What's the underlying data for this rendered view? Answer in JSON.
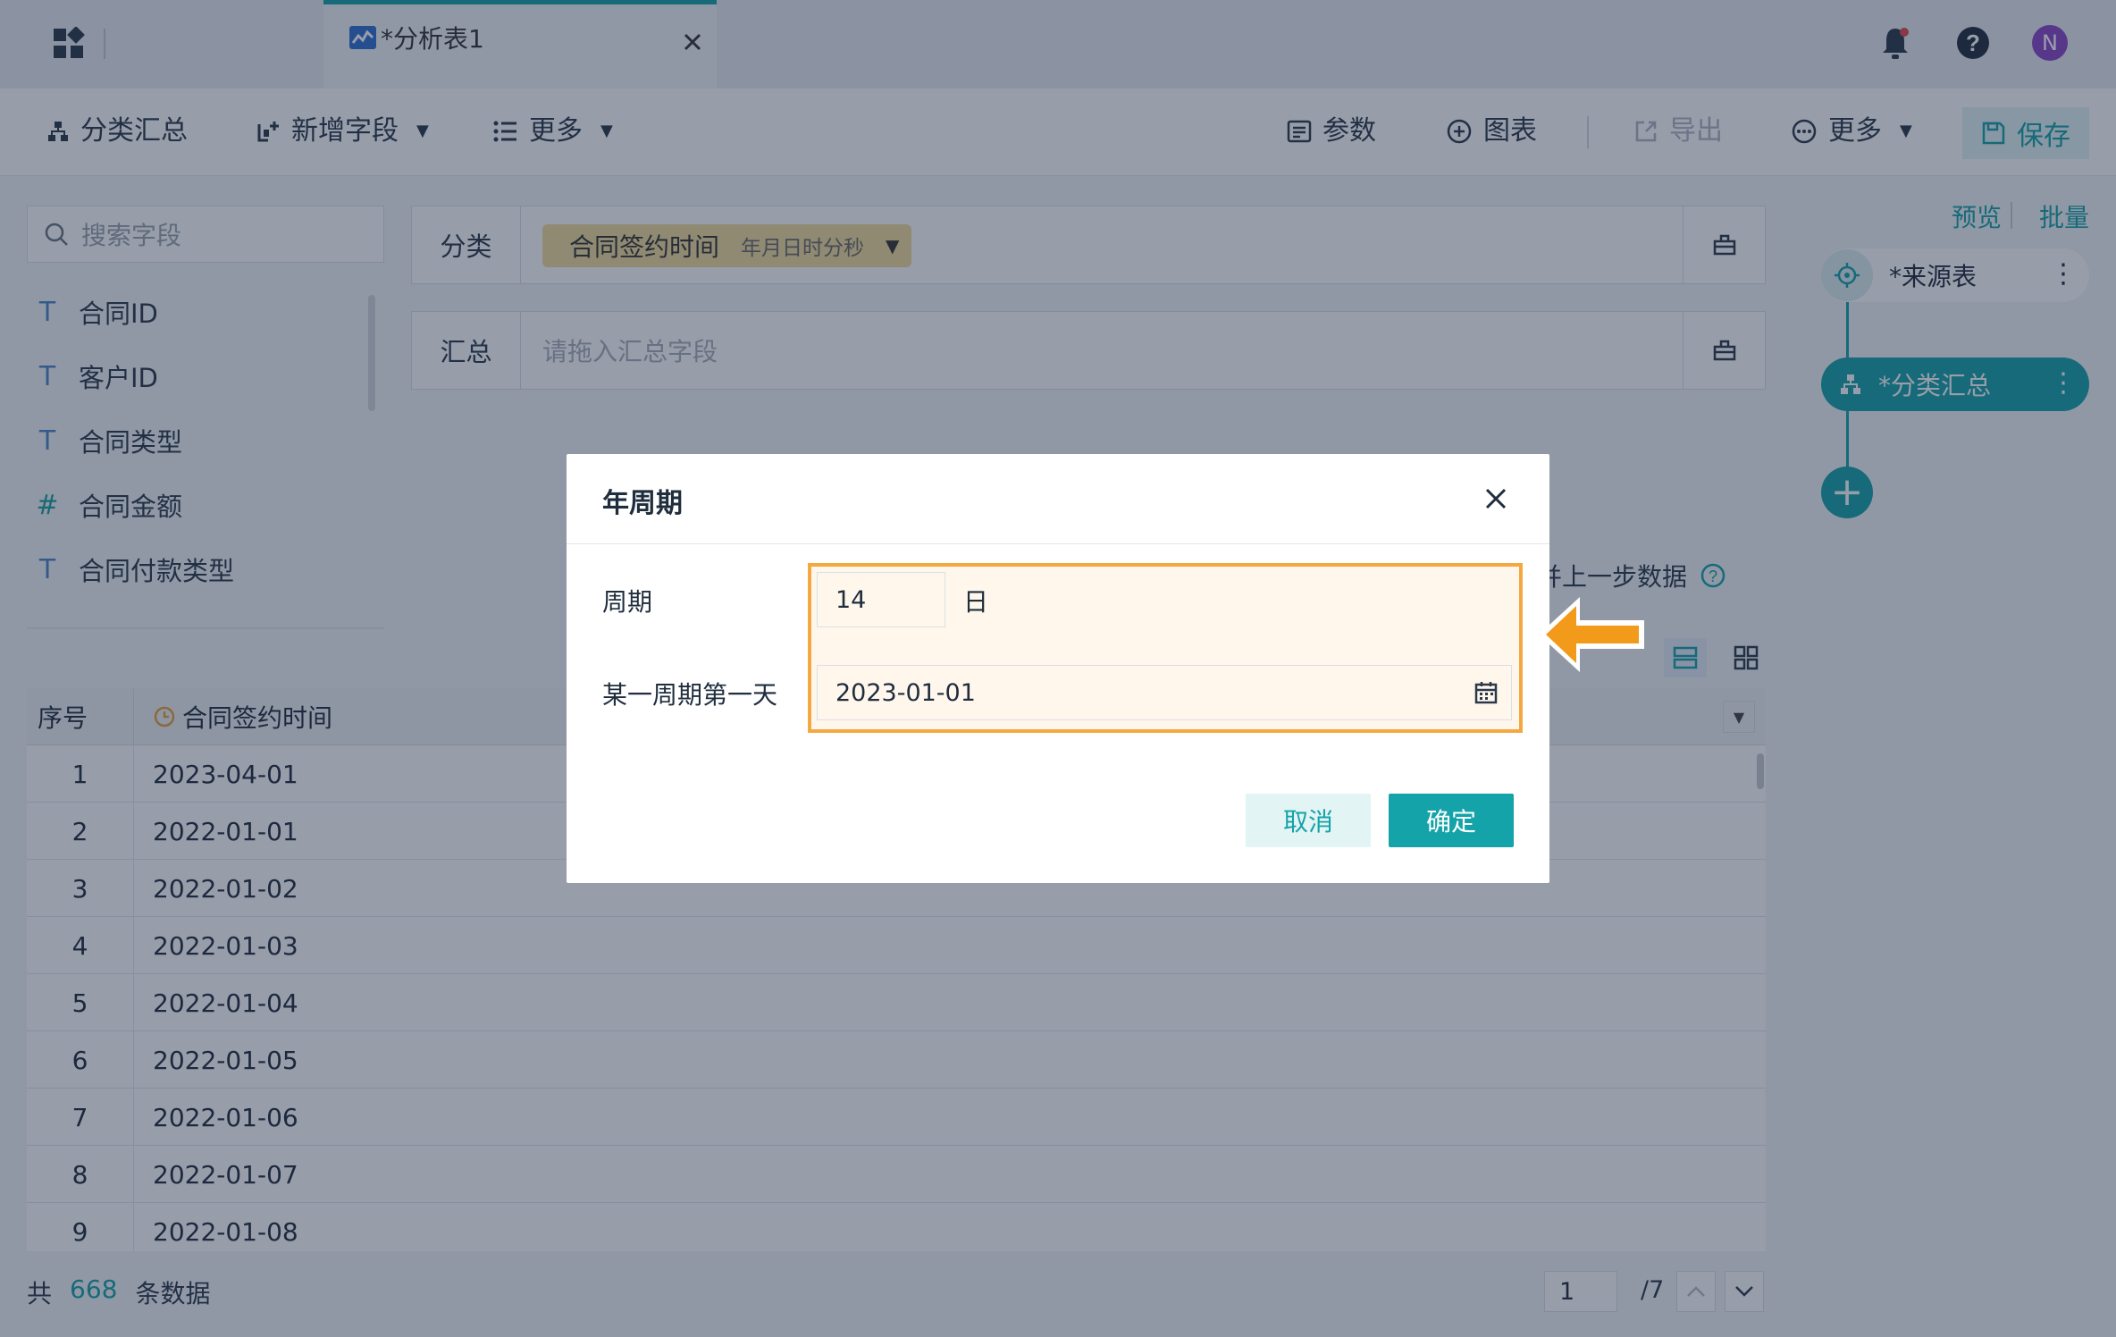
{
  "tab": {
    "title": "*分析表1"
  },
  "toolbar": {
    "group_summary": "分类汇总",
    "add_field": "新增字段",
    "more_left": "更多",
    "params": "参数",
    "chart": "图表",
    "export": "导出",
    "more_right": "更多",
    "save": "保存"
  },
  "left_panel": {
    "search_placeholder": "搜索字段",
    "fields": [
      {
        "type": "T",
        "name": "合同ID"
      },
      {
        "type": "T",
        "name": "客户ID"
      },
      {
        "type": "T",
        "name": "合同类型"
      },
      {
        "type": "#",
        "name": "合同金额"
      },
      {
        "type": "T",
        "name": "合同付款类型"
      }
    ]
  },
  "category_bar": {
    "label": "分类",
    "chip_field": "合同签约时间",
    "chip_format": "年月日时分秒"
  },
  "summary_bar": {
    "label": "汇总",
    "placeholder": "请拖入汇总字段"
  },
  "merge_text": "并上一步数据",
  "table": {
    "headers": [
      "序号",
      "合同签约时间"
    ],
    "rows": [
      [
        "1",
        "2023-04-01"
      ],
      [
        "2",
        "2022-01-01"
      ],
      [
        "3",
        "2022-01-02"
      ],
      [
        "4",
        "2022-01-03"
      ],
      [
        "5",
        "2022-01-04"
      ],
      [
        "6",
        "2022-01-05"
      ],
      [
        "7",
        "2022-01-06"
      ],
      [
        "8",
        "2022-01-07"
      ],
      [
        "9",
        "2022-01-08"
      ]
    ]
  },
  "footer": {
    "prefix": "共",
    "count": "668",
    "suffix": "条数据",
    "page": "1",
    "total": "/7"
  },
  "flow": {
    "preview": "预览",
    "batch": "批量",
    "source_node": "*来源表",
    "summary_node": "*分类汇总",
    "kebab": "⋮",
    "add": "+"
  },
  "user": {
    "avatar": "N"
  },
  "dialog": {
    "title": "年周期",
    "period_label": "周期",
    "period_value": "14",
    "period_unit": "日",
    "first_day_label": "某一周期第一天",
    "first_day_value": "2023-01-01",
    "cancel": "取消",
    "ok": "确定"
  },
  "colors": {
    "accent": "#14a3a8",
    "highlight": "#f4a842",
    "arrow": "#f29a1a"
  }
}
